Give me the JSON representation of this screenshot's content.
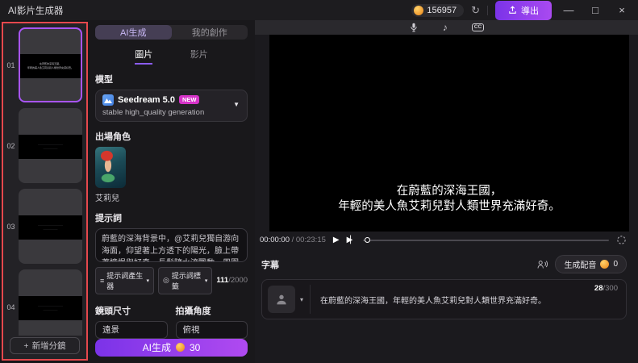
{
  "colors": {
    "accent_purple": "#8b5cf6",
    "button_gradient_start": "#7b33e8",
    "button_gradient_end": "#b04af0",
    "highlight_red": "#e5484d",
    "selected_thumb_purple": "#a855f7",
    "coin_orange": "#f09a2f",
    "badge_pink": "#d633c8"
  },
  "icons": {
    "plus": "+",
    "refresh": "↻",
    "minimize": "—",
    "maximize": "□",
    "close": "×",
    "chevron_down": "▼",
    "caret_down": "▾",
    "play": "▶",
    "step": "▶",
    "step_bar": "▏",
    "music_note": "♪",
    "cc": "CC",
    "prompt_gen": "≡",
    "prompt_tag": "◎"
  },
  "titlebar": {
    "title": "AI影片生成器",
    "credits": "156957",
    "export_label": "導出"
  },
  "storyboard": {
    "items": [
      {
        "index": "01",
        "caption_line1": "在蔚藍的深海王國，",
        "caption_line2": "年輕的美人魚艾莉兒對人類世界充滿好奇。",
        "selected": true
      },
      {
        "index": "02",
        "caption_line1": "·······························",
        "caption_line2": "··················"
      },
      {
        "index": "03",
        "caption_line1": "·······························",
        "caption_line2": "··················"
      },
      {
        "index": "04",
        "caption_line1": "·······························",
        "caption_line2": "··················"
      }
    ],
    "add_label": "新增分鏡"
  },
  "generator": {
    "tabs": {
      "ai": "AI生成",
      "mine": "我的創作"
    },
    "media_tabs": {
      "image": "圖片",
      "video": "影片"
    },
    "model": {
      "label": "模型",
      "name": "Seedream 5.0",
      "badge": "NEW",
      "subtitle": "stable high_quality generation"
    },
    "character": {
      "label": "出場角色",
      "name": "艾莉兒"
    },
    "prompt": {
      "label": "提示詞",
      "value": "蔚藍的深海背景中，@艾莉兒獨自游向海面，仰望著上方透下的陽光，臉上帶著憧憬與好奇，長髮隨水流飄動，周圍有魚群環繞",
      "generator_button": "提示詞產生器",
      "tags_button": "提示詞標籤",
      "count": "111",
      "max": "/2000"
    },
    "shot_size": {
      "label": "鏡頭尺寸",
      "value": "遠景"
    },
    "camera_angle": {
      "label": "拍攝角度",
      "value": "俯視"
    },
    "generate": {
      "label": "AI生成",
      "cost": "30"
    }
  },
  "player": {
    "subtitle_line1": "在蔚藍的深海王國，",
    "subtitle_line2": "年輕的美人魚艾莉兒對人類世界充滿好奇。",
    "current_time": "00:00:00",
    "duration": "/ 00:23:15"
  },
  "captions": {
    "label": "字幕",
    "voiceover_button": "生成配音",
    "voiceover_cost": "0",
    "row": {
      "text": "在蔚藍的深海王國，年輕的美人魚艾莉兒對人類世界充滿好奇。",
      "count": "28",
      "max": "/300"
    }
  }
}
